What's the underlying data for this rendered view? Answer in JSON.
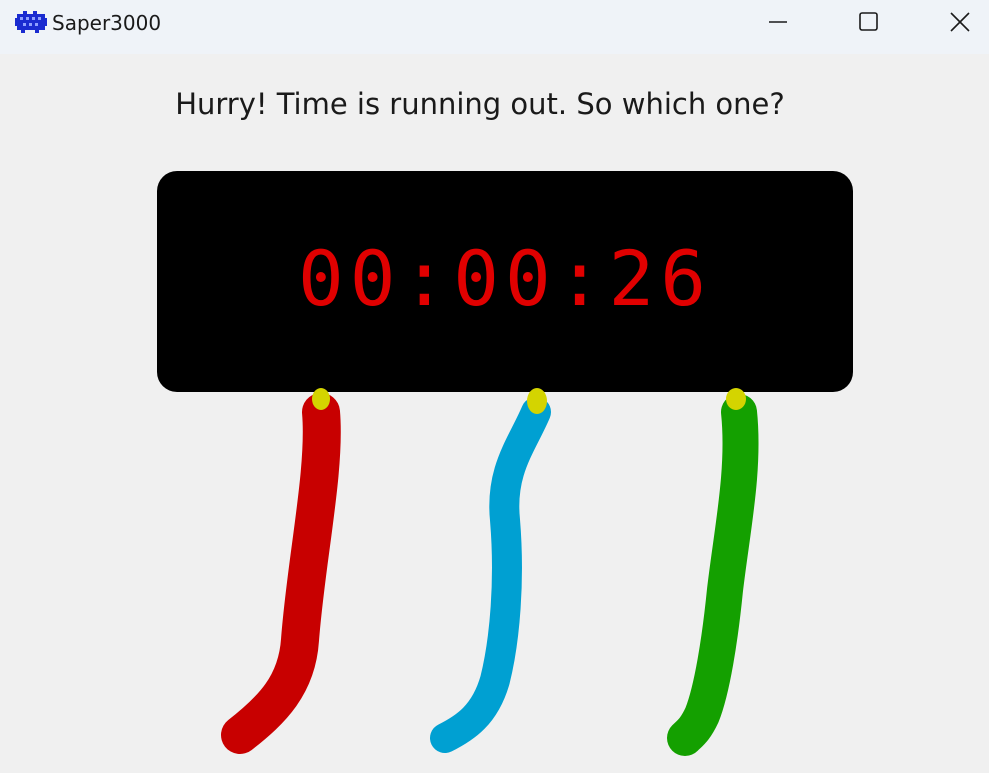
{
  "window": {
    "title": "Saper3000",
    "controls": {
      "minimize": "minimize-icon",
      "maximize": "maximize-icon",
      "close": "close-icon"
    }
  },
  "game": {
    "prompt": "Hurry! Time is running out. So which one?",
    "timer": "00:00:26",
    "timer_color": "#e00000",
    "wires": [
      {
        "color_name": "red",
        "color": "#c80000"
      },
      {
        "color_name": "blue",
        "color": "#00a0d2"
      },
      {
        "color_name": "green",
        "color": "#14a000"
      }
    ],
    "terminal_color": "#d4d400"
  }
}
